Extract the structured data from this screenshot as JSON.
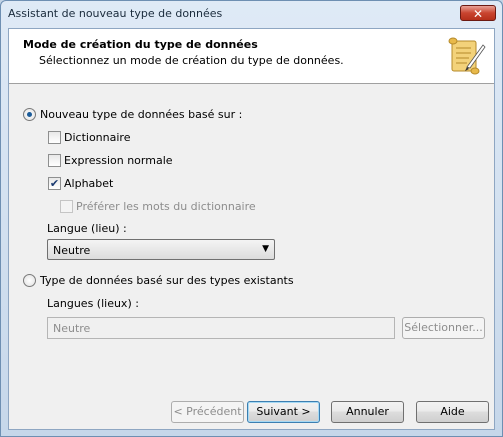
{
  "window": {
    "title": "Assistant de nouveau type de données",
    "close_glyph": "✕"
  },
  "header": {
    "title": "Mode de création du type de données",
    "subtitle": "Sélectionnez un mode de création du type de données."
  },
  "option_new": {
    "label": "Nouveau type de données basé sur :",
    "selected": true,
    "checkboxes": [
      {
        "label": "Dictionnaire",
        "checked": false,
        "enabled": true
      },
      {
        "label": "Expression normale",
        "checked": false,
        "enabled": true
      },
      {
        "label": "Alphabet",
        "checked": true,
        "enabled": true
      },
      {
        "label": "Préférer les mots du dictionnaire",
        "checked": false,
        "enabled": false
      }
    ],
    "langue_label": "Langue (lieu) :",
    "langue_value": "Neutre"
  },
  "option_existing": {
    "label": "Type de données basé sur des types existants",
    "selected": false,
    "langues_label": "Langues (lieux) :",
    "langues_value": "Neutre",
    "select_button": "Sélectionner..."
  },
  "footer": {
    "prev": "< Précédent",
    "next": "Suivant >",
    "cancel": "Annuler",
    "help": "Aide"
  },
  "icons": {
    "checkmark": "✔",
    "dropdown": "▼"
  },
  "colors": {
    "accent": "#1c5c99",
    "window_frame": "#c6d7ea",
    "close_button": "#c9442f"
  }
}
